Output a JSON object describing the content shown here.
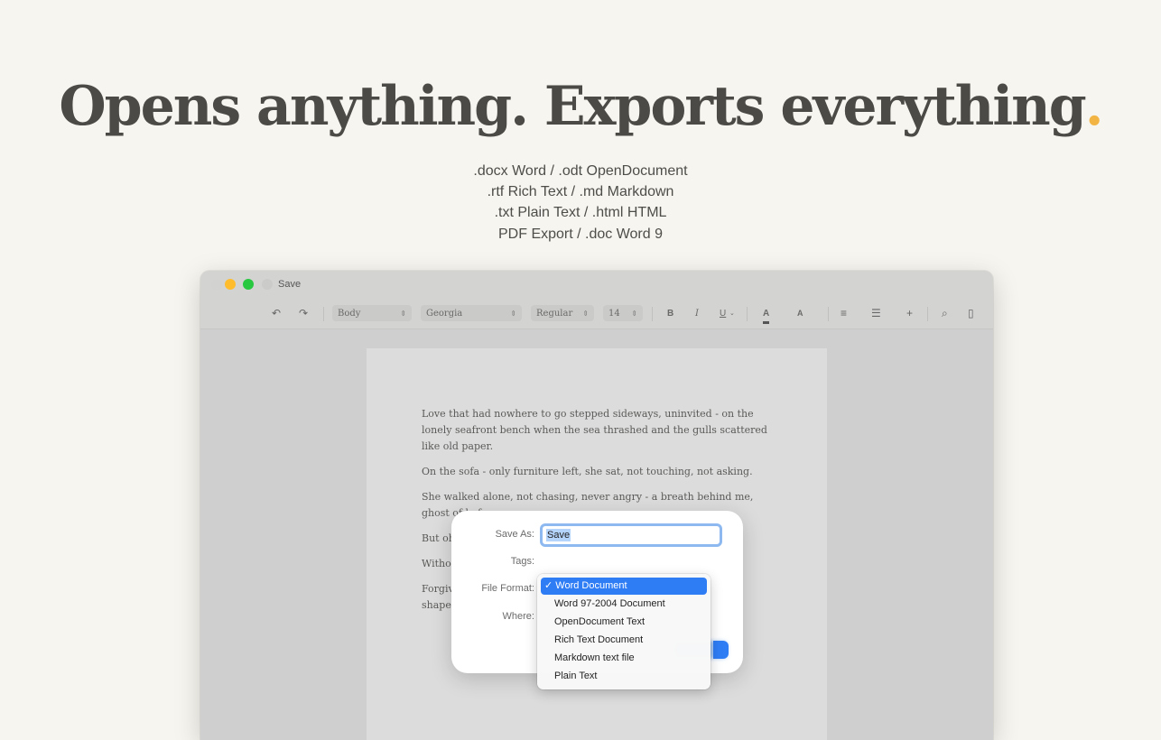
{
  "hero": {
    "headline": "Opens anything. Exports everything",
    "headline_dot": ".",
    "formats": [
      ".docx Word / .odt OpenDocument",
      ".rtf Rich Text / .md Markdown",
      ".txt Plain Text / .html HTML",
      "PDF Export / .doc Word 9"
    ]
  },
  "window": {
    "title": "Save",
    "traffic_lights": [
      "#ffbd2e",
      "#28c840"
    ],
    "toolbar": {
      "style": "Body",
      "font": "Georgia",
      "weight": "Regular",
      "size": "14",
      "bold": "B",
      "italic": "I",
      "underline": "U",
      "font_color": "A",
      "highlight": "A"
    },
    "icons": [
      "undo-icon",
      "redo-icon",
      "align-left-icon",
      "list-icon",
      "plus-icon",
      "search-icon",
      "sidebar-icon"
    ]
  },
  "document": {
    "paragraphs": [
      "Love that had nowhere to go stepped sideways, uninvited - on the lonely seafront bench when the sea thrashed and the gulls scattered like old paper.",
      "On the sofa - only furniture left, she sat, not touching, not asking.",
      "She walked alone, not chasing, never angry - a breath behind me, ghost of before.",
      "But oh",
      "Witho",
      "Forgiv",
      "shape"
    ]
  },
  "save_dialog": {
    "save_as_label": "Save As:",
    "save_as_value": "Save",
    "tags_label": "Tags:",
    "file_format_label": "File Format:",
    "where_label": "Where:",
    "check": "✓",
    "formats": [
      "Word Document",
      "Word 97-2004 Document",
      "OpenDocument Text",
      "Rich Text Document",
      "Markdown text file",
      "Plain Text"
    ],
    "accent_color": "#2f7df5"
  }
}
